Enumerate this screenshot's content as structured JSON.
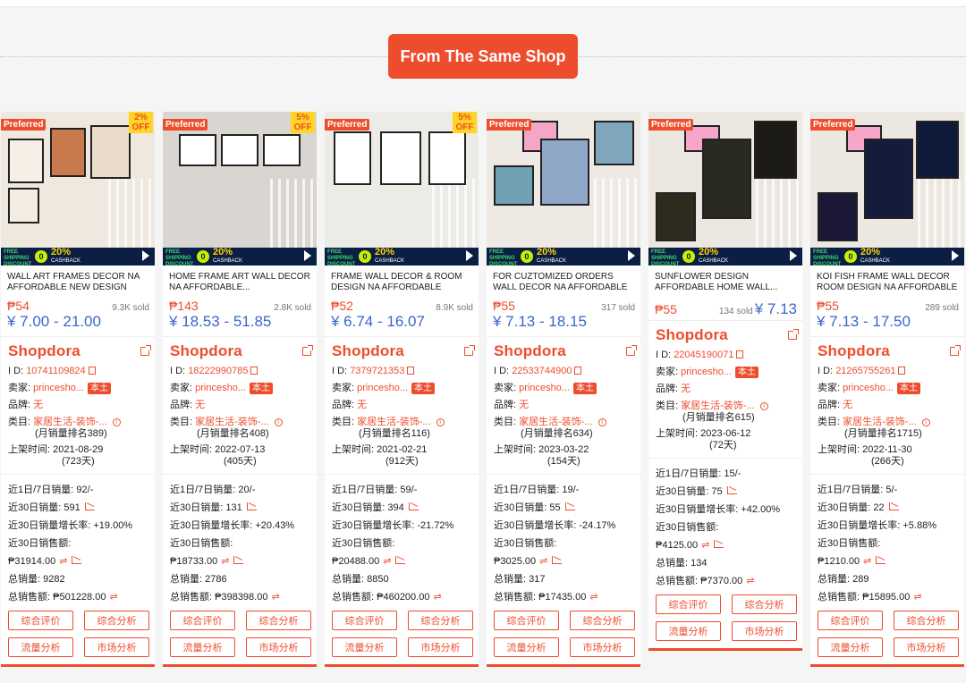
{
  "header": {
    "title": "From The Same Shop"
  },
  "labels": {
    "preferred": "Preferred",
    "id": "I D:",
    "seller": "卖家:",
    "brand": "品牌:",
    "category": "类目:",
    "listed": "上架时间:",
    "sales_1_7": "近1日/7日销量:",
    "sales_30": "近30日销量:",
    "growth_30": "近30日销量增长率:",
    "revenue_30": "近30日销售额:",
    "total_sales": "总销量:",
    "total_revenue": "总销售额:",
    "btn_review": "综合评价",
    "btn_analysis": "综合分析",
    "btn_traffic": "流量分析",
    "btn_market": "市场分析",
    "local": "本土",
    "logo": "Shopdora",
    "promo_free": "FREE SHIPPING DISCOUNT",
    "promo_zero": "0",
    "promo_pct": "20%",
    "promo_cash": "CASHBACK"
  },
  "colors": {
    "accent": "#ee4d2d",
    "price_range": "#3a66cc",
    "off_badge": "#ffd424"
  },
  "products": [
    {
      "title": "WALL ART FRAMES DECOR NA AFFORDABLE NEW DESIGN",
      "off": "2% OFF",
      "price": "₱54",
      "sold": "9.3K sold",
      "range": "¥ 7.00 - 21.00",
      "id": "10741109824",
      "seller": "princesho...",
      "brand": "无",
      "category": "家居生活-装饰-...",
      "rank": "(月销量排名389)",
      "listed_date": "2021-08-29",
      "listed_days": "(723天)",
      "s17": "92/-",
      "s30": "591",
      "growth": "+19.00%",
      "rev30": "₱31914.00",
      "total": "9282",
      "total_rev": "₱501228.00",
      "bg": "#efe8df"
    },
    {
      "title": "HOME FRAME ART WALL DECOR NA AFFORDABLE...",
      "off": "5% OFF",
      "price": "₱143",
      "sold": "2.8K sold",
      "range": "¥ 18.53 - 51.85",
      "id": "18222990785",
      "seller": "princesho...",
      "brand": "无",
      "category": "家居生活-装饰-...",
      "rank": "(月销量排名408)",
      "listed_date": "2022-07-13",
      "listed_days": "(405天)",
      "s17": "20/-",
      "s30": "131",
      "growth": "+20.43%",
      "rev30": "₱18733.00",
      "total": "2786",
      "total_rev": "₱398398.00",
      "bg": "#d9d6d2"
    },
    {
      "title": "FRAME WALL DECOR & ROOM DESIGN NA AFFORDABLE",
      "off": "5% OFF",
      "price": "₱52",
      "sold": "8.9K sold",
      "range": "¥ 6.74 - 16.07",
      "id": "7379721353",
      "seller": "princesho...",
      "brand": "无",
      "category": "家居生活-装饰-...",
      "rank": "(月销量排名116)",
      "listed_date": "2021-02-21",
      "listed_days": "(912天)",
      "s17": "59/-",
      "s30": "394",
      "growth": "-21.72%",
      "rev30": "₱20488.00",
      "total": "8850",
      "total_rev": "₱460200.00",
      "bg": "#ecebe6"
    },
    {
      "title": "FOR CUZTOMIZED ORDERS WALL DECOR NA AFFORDABLE",
      "off": "",
      "price": "₱55",
      "sold": "317 sold",
      "range": "¥ 7.13 - 18.15",
      "id": "22533744900",
      "seller": "princesho...",
      "brand": "无",
      "category": "家居生活-装饰-...",
      "rank": "(月销量排名634)",
      "listed_date": "2023-03-22",
      "listed_days": "(154天)",
      "s17": "19/-",
      "s30": "55",
      "growth": "-24.17%",
      "rev30": "₱3025.00",
      "total": "317",
      "total_rev": "₱17435.00",
      "bg": "#eee9e3"
    },
    {
      "title": "SUNFLOWER DESIGN AFFORDABLE HOME WALL...",
      "off": "",
      "price": "₱55",
      "sold": "134 sold",
      "range": "¥ 7.13",
      "id": "22045190071",
      "seller": "princesho...",
      "brand": "无",
      "category": "家居生活-装饰-...",
      "rank": "(月销量排名615)",
      "listed_date": "2023-06-12",
      "listed_days": "(72天)",
      "s17": "15/-",
      "s30": "75",
      "growth": "+42.00%",
      "rev30": "₱4125.00",
      "total": "134",
      "total_rev": "₱7370.00",
      "bg": "#ece7e0"
    },
    {
      "title": "KOI FISH FRAME WALL DECOR ROOM DESIGN NA AFFORDABLE",
      "off": "",
      "price": "₱55",
      "sold": "289 sold",
      "range": "¥ 7.13 - 17.50",
      "id": "21265755261",
      "seller": "princesho...",
      "brand": "无",
      "category": "家居生活-装饰-...",
      "rank": "(月销量排名1715)",
      "listed_date": "2022-11-30",
      "listed_days": "(266天)",
      "s17": "5/-",
      "s30": "22",
      "growth": "+5.88%",
      "rev30": "₱1210.00",
      "total": "289",
      "total_rev": "₱15895.00",
      "bg": "#ece7e0"
    }
  ]
}
